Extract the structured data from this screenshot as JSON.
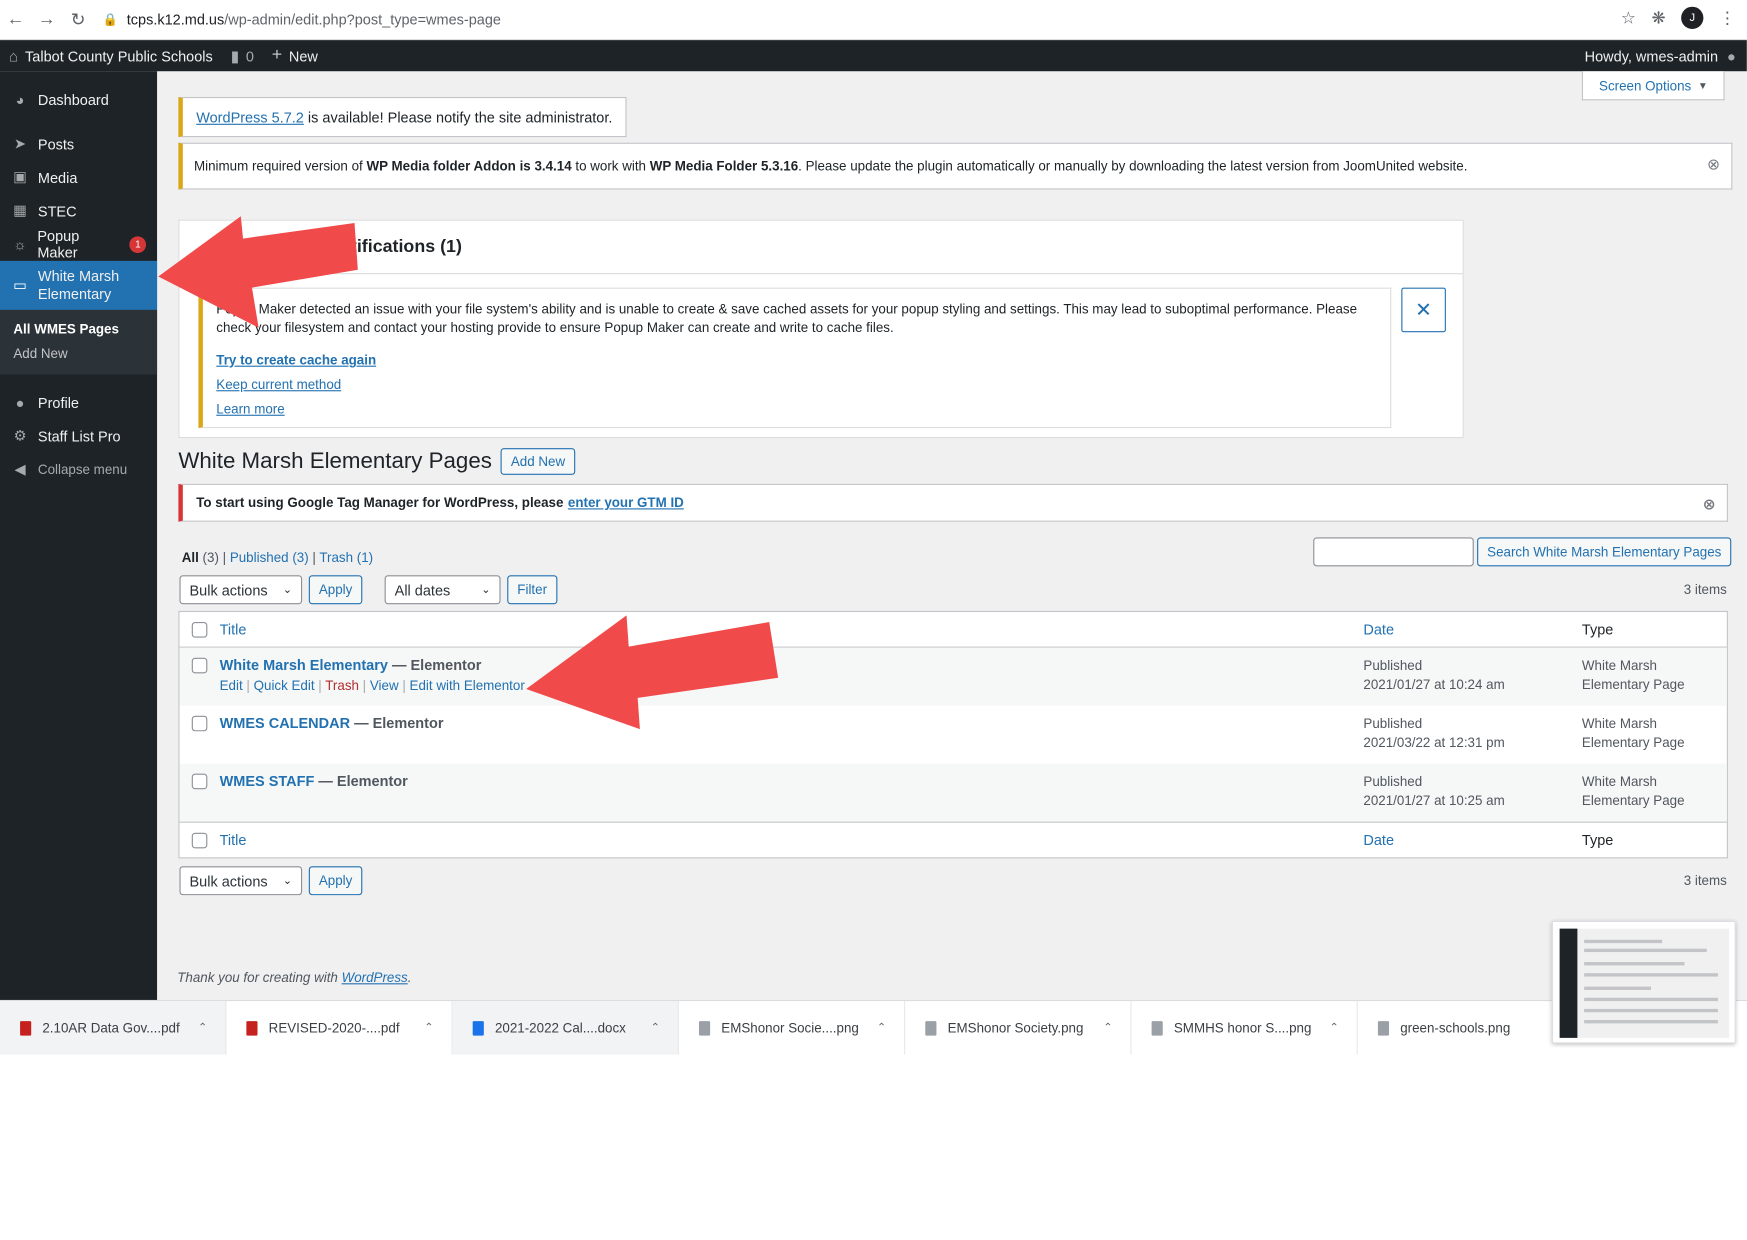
{
  "browser": {
    "url_host": "tcps.k12.md.us",
    "url_path": "/wp-admin/edit.php?post_type=wmes-page",
    "profile_initial": "J"
  },
  "adminbar": {
    "site_name": "Talbot County Public Schools",
    "comments_count": "0",
    "new_label": "New",
    "howdy": "Howdy, wmes-admin"
  },
  "sidebar": {
    "items": [
      {
        "label": "Dashboard",
        "icon": "dashboard-icon"
      },
      {
        "label": "Posts",
        "icon": "pin-icon"
      },
      {
        "label": "Media",
        "icon": "media-icon"
      },
      {
        "label": "STEC",
        "icon": "calendar-icon"
      },
      {
        "label": "Popup Maker",
        "icon": "popup-icon",
        "badge": "1"
      },
      {
        "label": "White Marsh Elementary",
        "icon": "page-icon"
      },
      {
        "label": "Profile",
        "icon": "user-icon"
      },
      {
        "label": "Staff List Pro",
        "icon": "group-icon"
      },
      {
        "label": "Collapse menu",
        "icon": "collapse-icon"
      }
    ],
    "submenu": {
      "current": "All WMES Pages",
      "add_new": "Add New"
    }
  },
  "screen_options": "Screen Options",
  "notices": {
    "update_link": "WordPress 5.7.2",
    "update_text": " is available! Please notify the site administrator.",
    "media_pre": "Minimum required version of ",
    "media_addon": "WP Media folder Addon is 3.4.14",
    "media_mid": " to work with ",
    "media_folder": "WP Media Folder 5.3.16",
    "media_post": ". Please update the plugin automatically or manually by downloading the latest version from JoomUnited website.",
    "popup_heading": "otifications (1)",
    "popup_body": "Popup Maker detected an issue with your file system's ability and is unable to create & save cached assets for your popup styling and settings. This may lead to suboptimal performance. Please check your filesystem and contact your hosting provide to ensure Popup Maker can create and write to cache files.",
    "popup_links": [
      "Try to create cache again",
      "Keep current method",
      "Learn more"
    ],
    "gtm_text": "To start using Google Tag Manager for WordPress, please",
    "gtm_link": "enter your GTM ID"
  },
  "page": {
    "title": "White Marsh Elementary Pages",
    "add_new": "Add New"
  },
  "filters": {
    "all": "All",
    "all_count": "(3)",
    "published": "Published",
    "published_count": "(3)",
    "trash": "Trash",
    "trash_count": "(1)",
    "search_button": "Search White Marsh Elementary Pages",
    "bulk_actions": "Bulk actions",
    "apply": "Apply",
    "all_dates": "All dates",
    "filter": "Filter",
    "items_count": "3 items"
  },
  "table": {
    "col_title": "Title",
    "col_date": "Date",
    "col_type": "Type",
    "rows": [
      {
        "title": "White Marsh Elementary",
        "state": " — Elementor",
        "status": "Published",
        "date": "2021/01/27 at 10:24 am",
        "type1": "White Marsh",
        "type2": "Elementary Page"
      },
      {
        "title": "WMES CALENDAR",
        "state": " — Elementor",
        "status": "Published",
        "date": "2021/03/22 at 12:31 pm",
        "type1": "White Marsh",
        "type2": "Elementary Page"
      },
      {
        "title": "WMES STAFF",
        "state": " — Elementor",
        "status": "Published",
        "date": "2021/01/27 at 10:25 am",
        "type1": "White Marsh",
        "type2": "Elementary Page"
      }
    ],
    "row_actions": {
      "edit": "Edit",
      "quick_edit": "Quick Edit",
      "trash": "Trash",
      "view": "View",
      "elementor": "Edit with Elementor"
    }
  },
  "footer": {
    "text": "Thank you for creating with ",
    "link": "WordPress",
    "end": "."
  },
  "downloads": [
    {
      "name": "2.10AR Data Gov....pdf",
      "kind": "pdf"
    },
    {
      "name": "REVISED-2020-....pdf",
      "kind": "pdf"
    },
    {
      "name": "2021-2022 Cal....docx",
      "kind": "docx"
    },
    {
      "name": "EMShonor Socie....png",
      "kind": "png"
    },
    {
      "name": "EMShonor Society.png",
      "kind": "png"
    },
    {
      "name": "SMMHS honor S....png",
      "kind": "png"
    },
    {
      "name": "green-schools.png",
      "kind": "png"
    }
  ],
  "colors": {
    "admin_dark": "#1d2327",
    "accent": "#2271b1",
    "warning": "#dba617",
    "error": "#d63638",
    "annotation_arrow": "#f04a4a"
  }
}
